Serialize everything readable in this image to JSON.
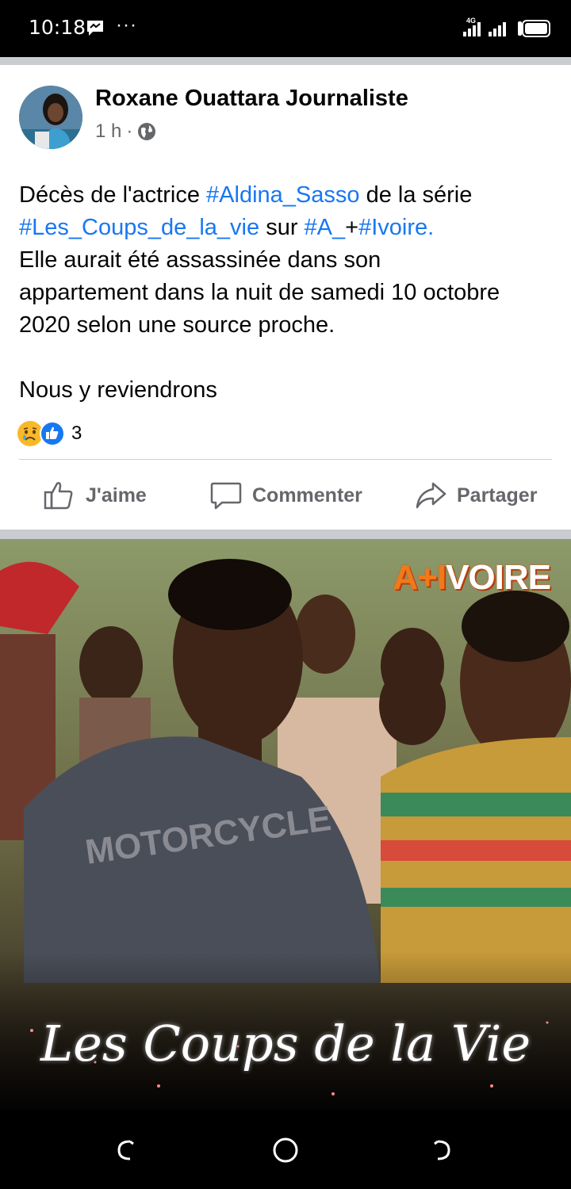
{
  "status_bar": {
    "time": "10:18",
    "icons": [
      "messenger-icon",
      "more-icon"
    ],
    "more": "···",
    "network_label": "4G"
  },
  "post": {
    "author": "Roxane Ouattara Journaliste",
    "time": "1 h",
    "separator": "·",
    "audience_icon": "globe-icon",
    "text": {
      "l1_a": "Décès de l'actrice ",
      "l1_tag": "#Aldina_Sasso",
      "l1_b": " de la  série",
      "l2_tag1": "#Les_Coups_de_la_vie",
      "l2_a": " sur ",
      "l2_tag2": "#A_",
      "l2_b": "+",
      "l2_tag3": "#Ivoire",
      "l2_c": ".",
      "l3": "Elle aurait été assassinée dans son",
      "l4": "appartement dans la nuit de samedi 10 octobre",
      "l5": "2020 selon une source proche.",
      "l6": "Nous y reviendrons"
    },
    "reactions": {
      "icons": [
        "sad-reaction-icon",
        "like-reaction-icon"
      ],
      "count": "3"
    },
    "actions": {
      "like": "J'aime",
      "comment": "Commenter",
      "share": "Partager"
    }
  },
  "image": {
    "brand": "VOIRE",
    "brand_prefix": "A+I",
    "title": "Les Coups de la Vie"
  },
  "nav_bar": {
    "icons": [
      "back-icon",
      "home-icon",
      "recent-apps-icon"
    ]
  },
  "colors": {
    "link": "#1877f2",
    "secondary_text": "#65676b",
    "separator": "#c9ccd1"
  }
}
